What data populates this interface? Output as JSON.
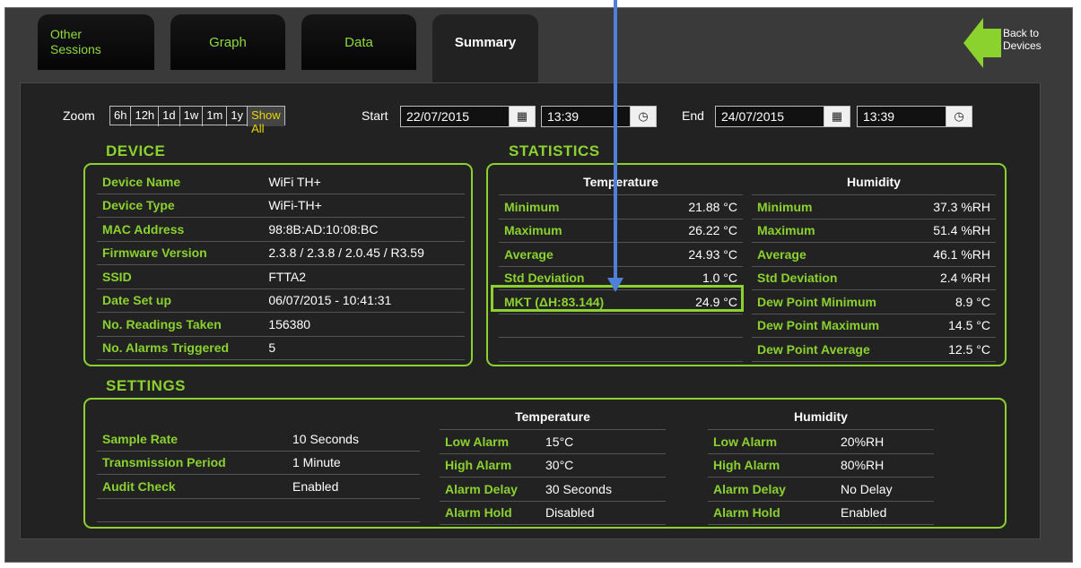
{
  "tabs": [
    {
      "label": "Other\nSessions",
      "active": false
    },
    {
      "label": "Graph",
      "active": false
    },
    {
      "label": "Data",
      "active": false
    },
    {
      "label": "Summary",
      "active": true
    }
  ],
  "back_button": {
    "label_line1": "Back to",
    "label_line2": "Devices",
    "icon": "arrow-left-icon"
  },
  "toolbar": {
    "zoom_label": "Zoom",
    "zoom_options": [
      "6h",
      "12h",
      "1d",
      "1w",
      "1m",
      "1y",
      "Show All"
    ],
    "start_label": "Start",
    "start_date": "22/07/2015",
    "start_time": "13:39",
    "end_label": "End",
    "end_date": "24/07/2015",
    "end_time": "13:39"
  },
  "device": {
    "title": "DEVICE",
    "rows": [
      {
        "key": "Device Name",
        "value": "WiFi TH+"
      },
      {
        "key": "Device Type",
        "value": "WiFi-TH+"
      },
      {
        "key": "MAC Address",
        "value": "98:8B:AD:10:08:BC"
      },
      {
        "key": "Firmware Version",
        "value": "2.3.8 / 2.3.8 / 2.0.45 / R3.59"
      },
      {
        "key": "SSID",
        "value": "FTTA2"
      },
      {
        "key": "Date Set up",
        "value": "06/07/2015 - 10:41:31"
      },
      {
        "key": "No. Readings Taken",
        "value": "156380"
      },
      {
        "key": "No. Alarms Triggered",
        "value": "5"
      }
    ]
  },
  "statistics": {
    "title": "STATISTICS",
    "temperature_header": "Temperature",
    "humidity_header": "Humidity",
    "temperature": [
      {
        "key": "Minimum",
        "value": "21.88 °C"
      },
      {
        "key": "Maximum",
        "value": "26.22 °C"
      },
      {
        "key": "Average",
        "value": "24.93 °C"
      },
      {
        "key": "Std Deviation",
        "value": "1.0 °C"
      },
      {
        "key": "MKT (ΔH:83.144)",
        "value": "24.9 °C"
      },
      {
        "key": "",
        "value": ""
      },
      {
        "key": "",
        "value": ""
      }
    ],
    "humidity": [
      {
        "key": "Minimum",
        "value": "37.3 %RH"
      },
      {
        "key": "Maximum",
        "value": "51.4 %RH"
      },
      {
        "key": "Average",
        "value": "46.1 %RH"
      },
      {
        "key": "Std Deviation",
        "value": "2.4 %RH"
      },
      {
        "key": "Dew Point Minimum",
        "value": "8.9 °C"
      },
      {
        "key": "Dew Point Maximum",
        "value": "14.5 °C"
      },
      {
        "key": "Dew Point Average",
        "value": "12.5 °C"
      }
    ]
  },
  "settings": {
    "title": "SETTINGS",
    "temperature_header": "Temperature",
    "humidity_header": "Humidity",
    "general": [
      {
        "key": "Sample Rate",
        "value": "10 Seconds"
      },
      {
        "key": "Transmission Period",
        "value": "1 Minute"
      },
      {
        "key": "Audit Check",
        "value": "Enabled"
      },
      {
        "key": "",
        "value": ""
      }
    ],
    "temperature": [
      {
        "key": "Low Alarm",
        "value": "15°C"
      },
      {
        "key": "High Alarm",
        "value": "30°C"
      },
      {
        "key": "Alarm Delay",
        "value": "30 Seconds"
      },
      {
        "key": "Alarm Hold",
        "value": "Disabled"
      }
    ],
    "humidity": [
      {
        "key": "Low Alarm",
        "value": "20%RH"
      },
      {
        "key": "High Alarm",
        "value": "80%RH"
      },
      {
        "key": "Alarm Delay",
        "value": "No Delay"
      },
      {
        "key": "Alarm Hold",
        "value": "Enabled"
      }
    ]
  },
  "colors": {
    "accent": "#8bd22f",
    "background": "#222222",
    "annotation_arrow": "#4f7fd6"
  }
}
